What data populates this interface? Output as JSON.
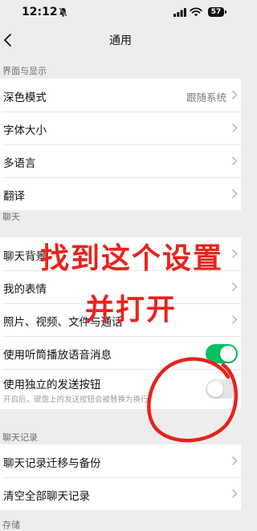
{
  "status_bar": {
    "time": "12:12",
    "battery": "57"
  },
  "nav": {
    "title": "通用"
  },
  "sections": {
    "display": {
      "header": "界面与显示",
      "rows": [
        {
          "label": "深色模式",
          "value": "跟随系统"
        },
        {
          "label": "字体大小"
        },
        {
          "label": "多语言"
        },
        {
          "label": "翻译"
        }
      ]
    },
    "chat": {
      "header": "聊天",
      "rows": [
        {
          "label": "聊天背景"
        },
        {
          "label": "我的表情"
        },
        {
          "label": "照片、视频、文件与通话"
        },
        {
          "label": "使用听筒播放语音消息",
          "toggle": true
        },
        {
          "label": "使用独立的发送按钮",
          "description": "开启后，键盘上的发送按钮会被替换为换行",
          "toggle": false
        }
      ]
    },
    "history": {
      "header": "聊天记录",
      "rows": [
        {
          "label": "聊天记录迁移与备份"
        },
        {
          "label": "清空全部聊天记录"
        }
      ]
    },
    "storage": {
      "header": "存储"
    }
  },
  "annotation": {
    "line1": "找到这个设置",
    "line2": "并打开",
    "color": "#e8231d"
  },
  "colors": {
    "accent": "#07c160",
    "background": "#ededed"
  }
}
